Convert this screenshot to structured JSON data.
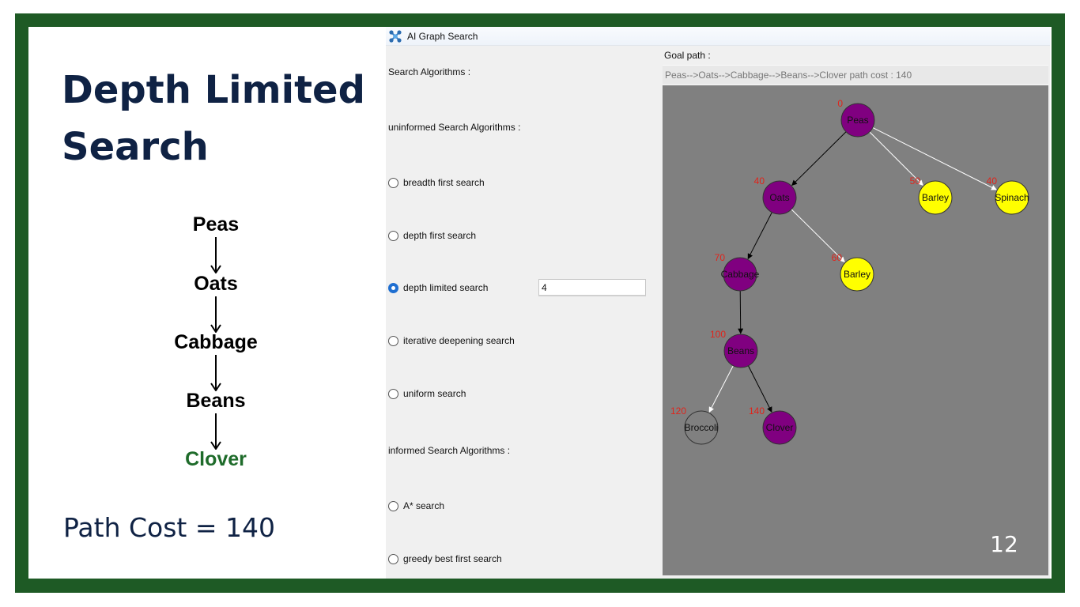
{
  "slide": {
    "title_line1": "Depth Limited",
    "title_line2": "Search",
    "flow": [
      "Peas",
      "Oats",
      "Cabbage",
      "Beans",
      "Clover"
    ],
    "path_cost": "Path Cost = 140",
    "page_number": "12"
  },
  "app": {
    "title": "AI Graph Search",
    "search_algorithms_label": "Search Algorithms :",
    "uninformed_label": "uninformed Search Algorithms :",
    "informed_label": "informed Search Algorithms :",
    "algorithms": [
      {
        "label": "breadth first search",
        "selected": false
      },
      {
        "label": "depth first search",
        "selected": false
      },
      {
        "label": "depth limited search",
        "selected": true
      },
      {
        "label": "iterative deepening search",
        "selected": false
      },
      {
        "label": "uniform search",
        "selected": false
      },
      {
        "label": "A* search",
        "selected": false
      },
      {
        "label": "greedy best first search",
        "selected": false
      }
    ],
    "depth_limit_value": "4",
    "goal_path_label": "Goal path :",
    "goal_path_text": "Peas-->Oats-->Cabbage-->Beans-->Clover   path cost : 140"
  },
  "graph": {
    "colors": {
      "visited": "#800080",
      "frontier": "#ffff00",
      "unvisited": "#808080",
      "cost": "#e0241b"
    },
    "nodes": [
      {
        "id": "peas",
        "label": "Peas",
        "cost": "0",
        "state": "visited"
      },
      {
        "id": "oats",
        "label": "Oats",
        "cost": "40",
        "state": "visited"
      },
      {
        "id": "barley1",
        "label": "Barley",
        "cost": "50",
        "state": "frontier"
      },
      {
        "id": "spinach",
        "label": "Spinach",
        "cost": "40",
        "state": "frontier"
      },
      {
        "id": "cabbage",
        "label": "Cabbage",
        "cost": "70",
        "state": "visited"
      },
      {
        "id": "barley2",
        "label": "Barley",
        "cost": "60",
        "state": "frontier"
      },
      {
        "id": "beans",
        "label": "Beans",
        "cost": "100",
        "state": "visited"
      },
      {
        "id": "broccoli",
        "label": "Broccoli",
        "cost": "120",
        "state": "unvisited"
      },
      {
        "id": "clover",
        "label": "Clover",
        "cost": "140",
        "state": "visited"
      }
    ],
    "edges": [
      {
        "from": "peas",
        "to": "oats",
        "path": true
      },
      {
        "from": "peas",
        "to": "barley1",
        "path": false
      },
      {
        "from": "peas",
        "to": "spinach",
        "path": false
      },
      {
        "from": "oats",
        "to": "cabbage",
        "path": true
      },
      {
        "from": "oats",
        "to": "barley2",
        "path": false
      },
      {
        "from": "cabbage",
        "to": "beans",
        "path": true
      },
      {
        "from": "beans",
        "to": "broccoli",
        "path": false
      },
      {
        "from": "beans",
        "to": "clover",
        "path": true
      }
    ]
  }
}
